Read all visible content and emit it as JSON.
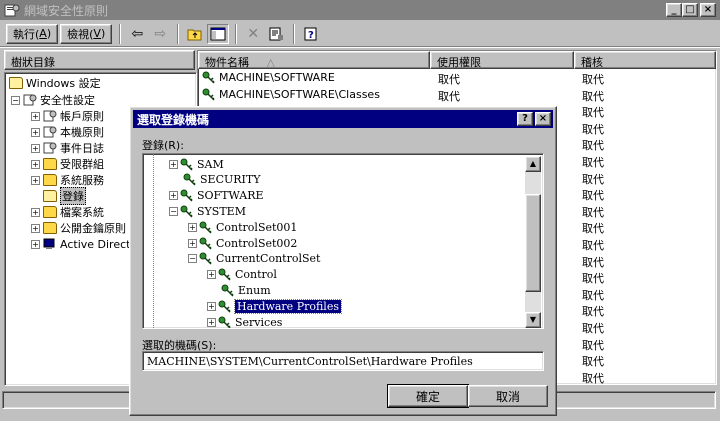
{
  "window": {
    "title": "網域安全性原則",
    "min_glyph": "_",
    "max_glyph": "□",
    "close_glyph": "×"
  },
  "toolbar": {
    "action_label": "執行(",
    "action_key": "A",
    "action_end": ")",
    "view_label": "檢視(",
    "view_key": "V",
    "view_end": ")",
    "back_glyph": "⇦",
    "fwd_glyph": "⇨",
    "delete_glyph": "✕"
  },
  "left": {
    "header": "樹狀目錄",
    "items": [
      {
        "label": "Windows 設定"
      },
      {
        "label": "安全性設定"
      },
      {
        "label": "帳戶原則"
      },
      {
        "label": "本機原則"
      },
      {
        "label": "事件日誌"
      },
      {
        "label": "受限群組"
      },
      {
        "label": "系統服務"
      },
      {
        "label": "登錄"
      },
      {
        "label": "檔案系統"
      },
      {
        "label": "公開金鑰原則"
      },
      {
        "label": "Active Directory"
      }
    ]
  },
  "list": {
    "columns": [
      "物件名稱",
      "使用權限",
      "稽核"
    ],
    "sort_glyph": "△",
    "rows": [
      {
        "name": "MACHINE\\SOFTWARE",
        "perm": "取代",
        "audit": "取代"
      },
      {
        "name": "MACHINE\\SOFTWARE\\Classes",
        "perm": "取代",
        "audit": "取代"
      },
      {
        "name": "",
        "perm": "",
        "audit": "取代"
      },
      {
        "name": "",
        "perm": "",
        "audit": "取代"
      },
      {
        "name": "",
        "perm": "",
        "audit": "取代"
      },
      {
        "name": "",
        "perm": "",
        "audit": "取代"
      },
      {
        "name": "",
        "perm": "",
        "audit": "取代"
      },
      {
        "name": "",
        "perm": "",
        "audit": "取代"
      },
      {
        "name": "",
        "perm": "",
        "audit": "取代"
      },
      {
        "name": "",
        "perm": "",
        "audit": "取代"
      },
      {
        "name": "",
        "perm": "",
        "audit": "取代"
      },
      {
        "name": "",
        "perm": "",
        "audit": "取代"
      },
      {
        "name": "",
        "perm": "",
        "audit": "取代"
      },
      {
        "name": "",
        "perm": "",
        "audit": "取代"
      },
      {
        "name": "",
        "perm": "",
        "audit": "取代"
      },
      {
        "name": "",
        "perm": "",
        "audit": "取代"
      },
      {
        "name": "",
        "perm": "",
        "audit": "取代"
      },
      {
        "name": "",
        "perm": "",
        "audit": "取代"
      },
      {
        "name": "",
        "perm": "",
        "audit": "取代"
      }
    ]
  },
  "dialog": {
    "title": "選取登錄機碼",
    "help_glyph": "?",
    "close_glyph": "×",
    "registry_label": "登錄(R):",
    "tree": [
      {
        "label": "SAM",
        "level": 0,
        "pm": "+"
      },
      {
        "label": "SECURITY",
        "level": 0,
        "pm": ""
      },
      {
        "label": "SOFTWARE",
        "level": 0,
        "pm": "+"
      },
      {
        "label": "SYSTEM",
        "level": 0,
        "pm": "−"
      },
      {
        "label": "ControlSet001",
        "level": 1,
        "pm": "+"
      },
      {
        "label": "ControlSet002",
        "level": 1,
        "pm": "+"
      },
      {
        "label": "CurrentControlSet",
        "level": 1,
        "pm": "−"
      },
      {
        "label": "Control",
        "level": 2,
        "pm": "+"
      },
      {
        "label": "Enum",
        "level": 2,
        "pm": ""
      },
      {
        "label": "Hardware Profiles",
        "level": 2,
        "pm": "+"
      },
      {
        "label": "Services",
        "level": 2,
        "pm": "+"
      }
    ],
    "selected_label": "選取的機碼(S):",
    "selected_value": "MACHINE\\SYSTEM\\CurrentControlSet\\Hardware Profiles",
    "ok": "確定",
    "cancel": "取消"
  },
  "colors": {
    "face": "#c0c0c0",
    "active_title": "#000080",
    "inactive_title": "#808080",
    "key_icon": "#2f8f2f"
  },
  "icons": [
    "policy-icon",
    "folder-icon",
    "registry-key-icon",
    "up-folder-icon",
    "properties-icon",
    "help-icon"
  ]
}
